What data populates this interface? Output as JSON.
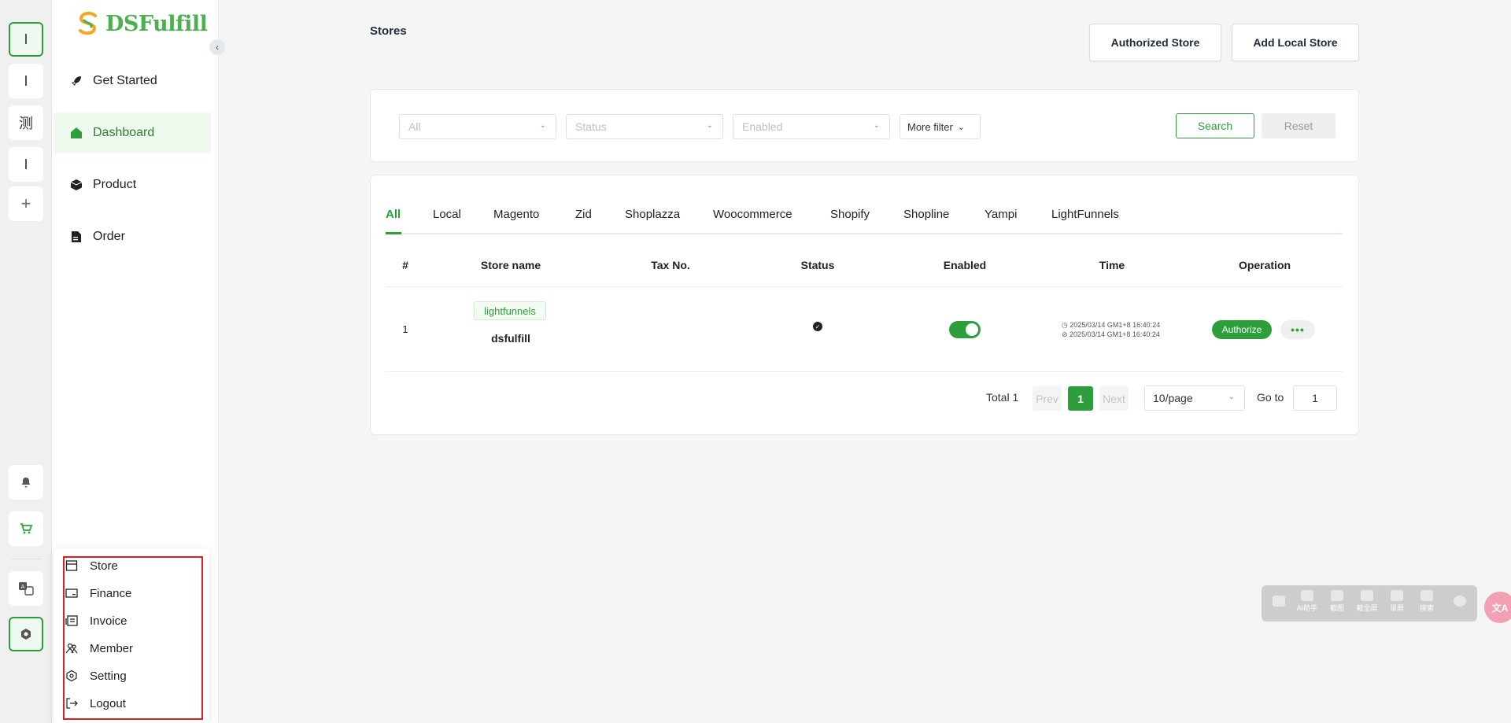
{
  "brand": {
    "name": "DSFulfill",
    "accent": "#2e9e3c",
    "logo_colors": [
      "#f6a623",
      "#4caf50"
    ]
  },
  "rail": {
    "items": [
      {
        "label": "I",
        "active": true
      },
      {
        "label": "I",
        "active": false
      },
      {
        "label": "测",
        "active": false
      },
      {
        "label": "I",
        "active": false
      },
      {
        "label": "+",
        "active": false
      }
    ],
    "bottom_icons": [
      "bell-icon",
      "cart-icon",
      "translate-icon",
      "settings-icon"
    ]
  },
  "sidebar": {
    "items": [
      {
        "label": "Get Started",
        "icon": "rocket-icon"
      },
      {
        "label": "Dashboard",
        "icon": "home-icon",
        "active": true
      },
      {
        "label": "Product",
        "icon": "box-icon"
      },
      {
        "label": "Order",
        "icon": "document-icon"
      }
    ]
  },
  "popup_menu": {
    "items": [
      {
        "label": "Store",
        "icon": "store-icon"
      },
      {
        "label": "Finance",
        "icon": "card-icon"
      },
      {
        "label": "Invoice",
        "icon": "invoice-icon"
      },
      {
        "label": "Member",
        "icon": "member-icon"
      },
      {
        "label": "Setting",
        "icon": "setting-icon"
      },
      {
        "label": "Logout",
        "icon": "logout-icon"
      }
    ]
  },
  "page": {
    "title": "Stores",
    "authorized_store_label": "Authorized Store",
    "add_local_store_label": "Add Local Store"
  },
  "filters": {
    "platform_placeholder": "All",
    "status_placeholder": "Status",
    "enabled_placeholder": "Enabled",
    "more_filter_label": "More filter",
    "search_label": "Search",
    "reset_label": "Reset"
  },
  "tabs": [
    "All",
    "Local",
    "Magento",
    "Zid",
    "Shoplazza",
    "Woocommerce",
    "Shopify",
    "Shopline",
    "Yampi",
    "LightFunnels"
  ],
  "table": {
    "headers": [
      "#",
      "Store name",
      "Tax No.",
      "Status",
      "Enabled",
      "Time",
      "Operation"
    ],
    "rows": [
      {
        "index": "1",
        "platform_tag": "lightfunnels",
        "store_name": "dsfulfill",
        "tax_no": "",
        "enabled": true,
        "time_created": "2025/03/14 GM1+8 16:40:24",
        "time_updated": "2025/03/14 GM1+8 16:40:24",
        "authorize_label": "Authorize",
        "more_label": "•••"
      }
    ]
  },
  "pagination": {
    "total_label": "Total 1",
    "prev_label": "Prev",
    "current_page": "1",
    "next_label": "Next",
    "page_size": "10/page",
    "goto_label": "Go to",
    "goto_value": "1"
  },
  "float_toolbar": {
    "items": [
      "AI助手",
      "截图",
      "截全屏",
      "录屏",
      "搜索"
    ],
    "badge": "文A"
  }
}
